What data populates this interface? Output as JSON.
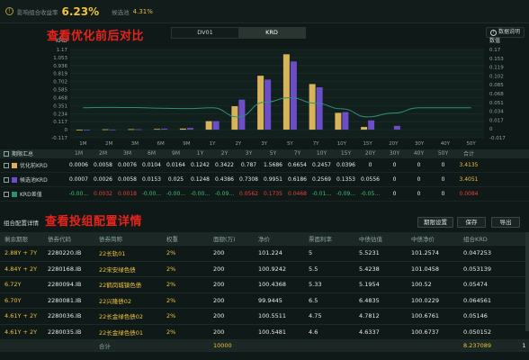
{
  "top": {
    "yield_label": "影响组合收益率",
    "yield_value": "6.23%",
    "candidate_label": "候选池",
    "candidate_value": "4.31%"
  },
  "toolbar": {
    "tabs": [
      "DV01",
      "KRD"
    ],
    "active_tab": "KRD",
    "help_label": "数据说明"
  },
  "annotations": {
    "compare": "查看优化前后对比",
    "detail": "查看投组配置详情"
  },
  "chart_data": {
    "type": "bar",
    "left_axis_label": "KRD",
    "right_axis_label": "数值",
    "left_ticks": [
      "1.17",
      "1.053",
      "0.936",
      "0.819",
      "0.702",
      "0.585",
      "0.468",
      "0.351",
      "0.234",
      "0.117",
      "0",
      "-0.117"
    ],
    "right_ticks": [
      "0.17",
      "0.153",
      "0.119",
      "0.102",
      "0.085",
      "0.068",
      "0.051",
      "0.034",
      "0.017",
      "0",
      "-0.017"
    ],
    "categories": [
      "1M",
      "2M",
      "3M",
      "6M",
      "9M",
      "1Y",
      "2Y",
      "3Y",
      "5Y",
      "7Y",
      "10Y",
      "15Y",
      "20Y",
      "30Y",
      "40Y",
      "50Y"
    ],
    "ylim": [
      -0.117,
      1.17
    ],
    "series": [
      {
        "name": "优化前KRD",
        "color": "#d9b35a",
        "values": [
          0.0006,
          0.0058,
          0.0076,
          0.0104,
          0.0164,
          0.1242,
          0.3422,
          0.787,
          1.1,
          0.6654,
          0.2457,
          0.0396,
          0,
          0,
          0,
          0
        ]
      },
      {
        "name": "候选池KRD",
        "color": "#6b4ec8",
        "values": [
          0.0007,
          0.0026,
          0.0058,
          0.0153,
          0.025,
          0.1248,
          0.4386,
          0.7308,
          0.9951,
          0.6186,
          0.2569,
          0.1353,
          0.0556,
          0,
          0,
          0
        ]
      }
    ],
    "diff_series": {
      "name": "KRD差值",
      "color": "#2f8f76"
    }
  },
  "matrix": {
    "header_label": "期限汇总",
    "total_header": "合计",
    "rows": [
      {
        "label": "优化前KRD",
        "color": "#d9b35a",
        "values": [
          "0.0006",
          "0.0058",
          "0.0076",
          "0.0104",
          "0.0164",
          "0.1242",
          "0.3422",
          "0.787",
          "1.5686",
          "0.6654",
          "0.2457",
          "0.0396",
          "0",
          "0",
          "0",
          "0"
        ],
        "total": "3.4135"
      },
      {
        "label": "候选池KRD",
        "color": "#6b4ec8",
        "values": [
          "0.0007",
          "0.0026",
          "0.0058",
          "0.0153",
          "0.025",
          "0.1248",
          "0.4386",
          "0.7308",
          "0.9951",
          "0.6186",
          "0.2569",
          "0.1353",
          "0.0556",
          "0",
          "0",
          "0"
        ],
        "total": "3.4051"
      },
      {
        "label": "KRD差值",
        "color": "#2f8f76",
        "values": [
          "-0.00…",
          "0.0032",
          "0.0018",
          "-0.00…",
          "-0.00…",
          "-0.00…",
          "-0.09…",
          "0.0562",
          "0.1735",
          "0.0468",
          "-0.01…",
          "-0.09…",
          "-0.05…",
          "0",
          "0",
          "0"
        ],
        "total": "0.0084"
      }
    ]
  },
  "detail": {
    "title": "组合配置详情",
    "buttons": {
      "settings": "期限设置",
      "save": "保存",
      "export": "导出"
    },
    "columns": [
      "剩余期限",
      "债券代码",
      "债券简称",
      "权重",
      "面额(万)",
      "净价",
      "票面利率",
      "中债估值",
      "中债净价",
      "组合KRD"
    ],
    "rows": [
      [
        "2.88Y + 7Y",
        "2280220.IB",
        "22长轨01",
        "2%",
        "200",
        "101.224",
        "5",
        "5.5231",
        "101.2574",
        "0.047253"
      ],
      [
        "4.84Y + 2Y",
        "2280168.IB",
        "22宋安绿色债",
        "2%",
        "200",
        "100.9242",
        "5.5",
        "5.4238",
        "101.0458",
        "0.053139"
      ],
      [
        "6.72Y",
        "2280094.IB",
        "22鹤岗城镇色债",
        "2%",
        "200",
        "100.4368",
        "5.33",
        "5.1954",
        "100.52",
        "0.05474"
      ],
      [
        "6.70Y",
        "2280081.IB",
        "22兴隆债02",
        "2%",
        "200",
        "99.9445",
        "6.5",
        "6.4835",
        "100.0229",
        "0.064561"
      ],
      [
        "4.61Y + 2Y",
        "2280036.IB",
        "22长金绿色债02",
        "2%",
        "200",
        "100.5511",
        "4.75",
        "4.7812",
        "100.6761",
        "0.05146"
      ],
      [
        "4.61Y + 2Y",
        "2280035.IB",
        "22长金绿色债01",
        "2%",
        "200",
        "100.5481",
        "4.6",
        "4.6337",
        "100.6737",
        "0.050152"
      ]
    ],
    "total_row": {
      "label": "合计",
      "face_total": "10000",
      "krd_total": "8.237089",
      "page": "1"
    }
  }
}
